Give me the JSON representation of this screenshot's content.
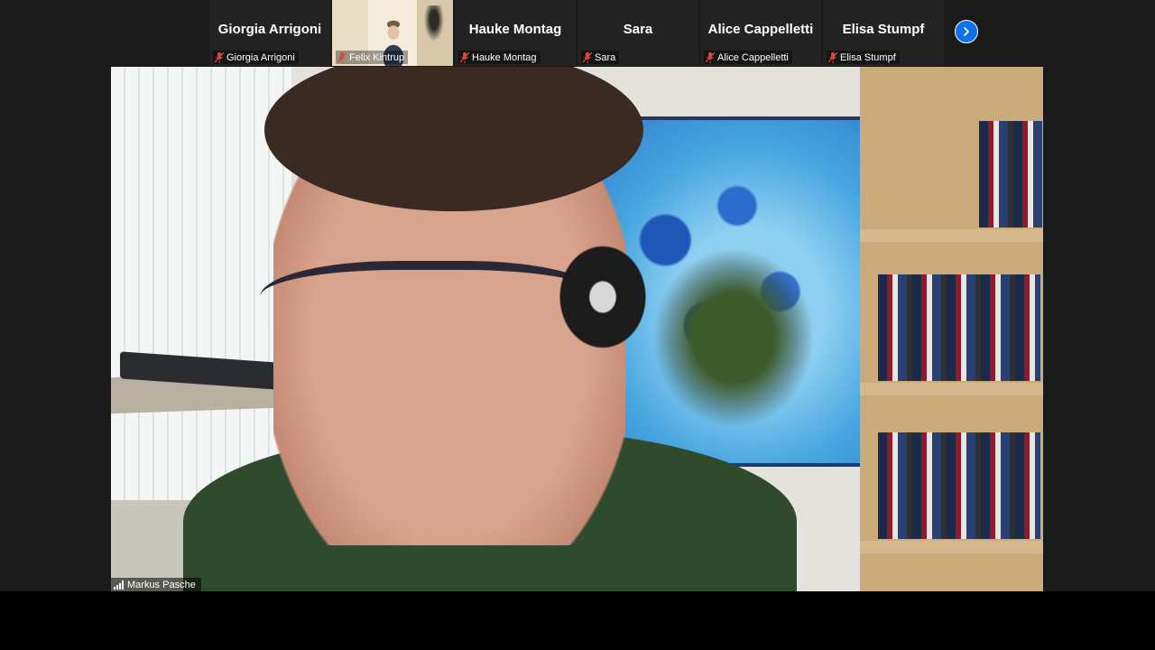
{
  "gallery": {
    "participants": [
      {
        "name": "Giorgia Arrigoni",
        "label": "Giorgia Arrigoni",
        "muted": true,
        "video": false
      },
      {
        "name": "",
        "label": "Felix Kintrup",
        "muted": true,
        "video": true
      },
      {
        "name": "Hauke Montag",
        "label": "Hauke Montag",
        "muted": true,
        "video": false
      },
      {
        "name": "Sara",
        "label": "Sara",
        "muted": true,
        "video": false
      },
      {
        "name": "Alice Cappelletti",
        "label": "Alice Cappelletti",
        "muted": true,
        "video": false
      },
      {
        "name": "Elisa Stumpf",
        "label": "Elisa Stumpf",
        "muted": true,
        "video": false
      }
    ],
    "next_icon": "chevron-right-icon"
  },
  "active_speaker": {
    "label": "Markus Pasche",
    "icon": "signal-icon"
  },
  "colors": {
    "accent": "#0e71eb",
    "muted_mic": "#e0463c",
    "tile_bg": "#232323"
  }
}
